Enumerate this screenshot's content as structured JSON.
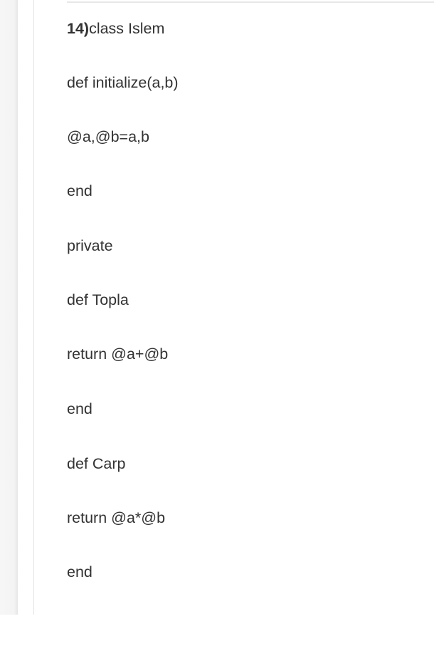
{
  "question": {
    "number": "14)",
    "lines": [
      "class Islem",
      "def initialize(a,b)",
      "@a,@b=a,b",
      "end",
      "private",
      "def Topla",
      "return @a+@b",
      "end",
      "def Carp",
      "return @a*@b",
      "end"
    ]
  }
}
